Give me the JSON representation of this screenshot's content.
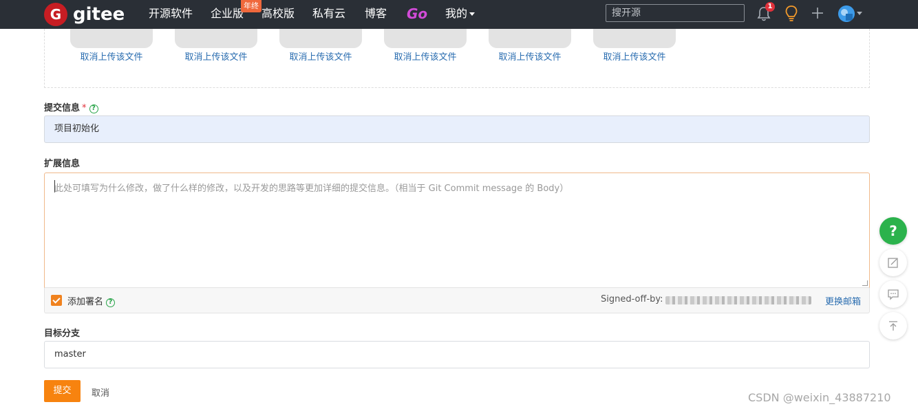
{
  "nav": {
    "logo_letter": "G",
    "logo_text": "gitee",
    "items": [
      "开源软件",
      "企业版",
      "高校版",
      "私有云",
      "博客"
    ],
    "badge": "年终",
    "go": "Go",
    "mine": "我的",
    "search_placeholder": "搜开源",
    "notification_count": "1"
  },
  "upload": {
    "cancel_labels": [
      "取消上传该文件",
      "取消上传该文件",
      "取消上传该文件",
      "取消上传该文件",
      "取消上传该文件",
      "取消上传该文件"
    ]
  },
  "commit": {
    "label": "提交信息",
    "required_mark": "*",
    "value": "项目初始化"
  },
  "extended": {
    "label": "扩展信息",
    "placeholder": "此处可填写为什么修改，做了什么样的修改，以及开发的思路等更加详细的提交信息。（相当于 Git Commit message 的 Body）"
  },
  "signature": {
    "label": "添加署名",
    "signed_off_label": "Signed-off-by:",
    "change_email": "更换邮箱"
  },
  "branch": {
    "label": "目标分支",
    "value": "master"
  },
  "actions": {
    "submit": "提交",
    "cancel": "取消"
  },
  "float_help": "?",
  "watermark": "CSDN @weixin_43887210",
  "colors": {
    "nav_bg": "#2a2f36",
    "brand_red": "#c71d23",
    "accent_orange": "#f7830f",
    "help_green": "#2bb24c",
    "link_blue": "#2a6db0"
  }
}
